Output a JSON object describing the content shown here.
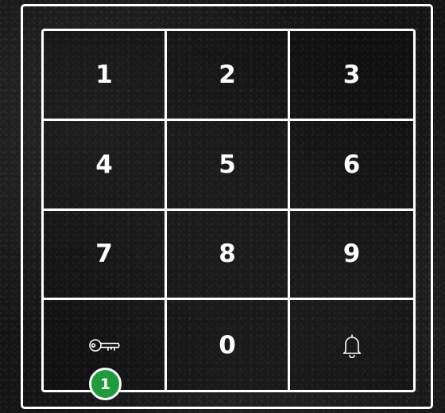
{
  "keypad": {
    "keys": [
      {
        "label": "1"
      },
      {
        "label": "2"
      },
      {
        "label": "3"
      },
      {
        "label": "4"
      },
      {
        "label": "5"
      },
      {
        "label": "6"
      },
      {
        "label": "7"
      },
      {
        "label": "8"
      },
      {
        "label": "9"
      },
      {
        "icon": "key-icon"
      },
      {
        "label": "0"
      },
      {
        "icon": "bell-icon"
      }
    ],
    "badge": "1"
  },
  "colors": {
    "background": "#141414",
    "lines": "#ffffff",
    "text": "#ffffff",
    "badge_fill": "#1e9b3a"
  }
}
